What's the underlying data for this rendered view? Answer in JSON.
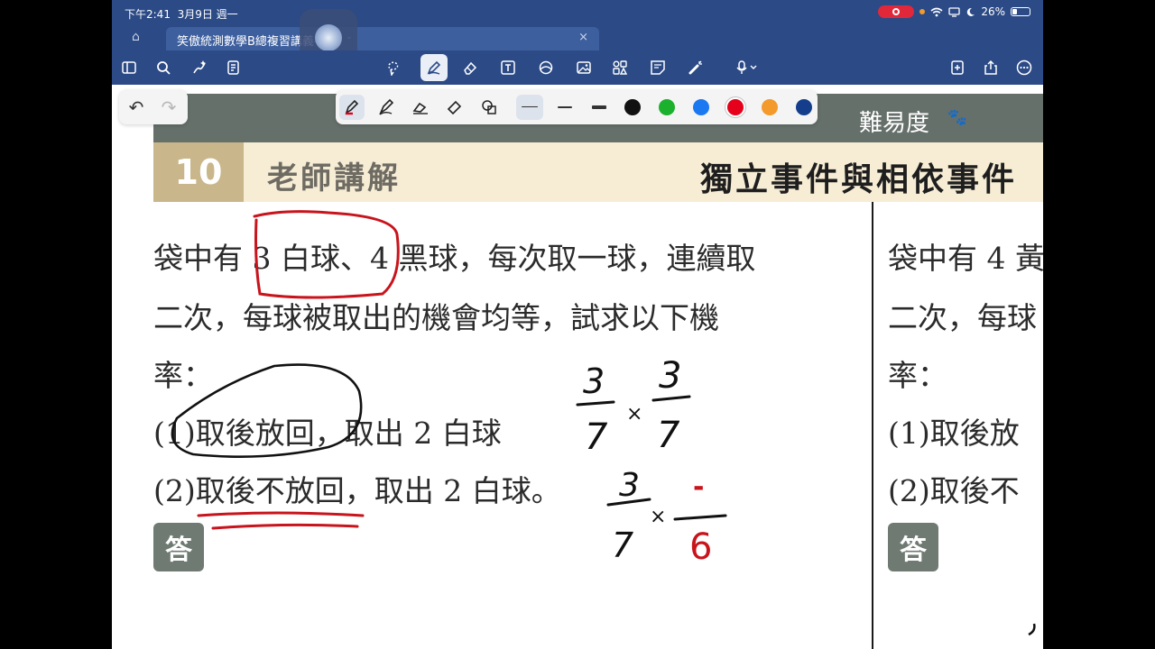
{
  "status_bar": {
    "time": "下午2:41",
    "date": "3月9日 週一",
    "battery": "26%"
  },
  "tab": {
    "title": "笑傲統測數學B總複習講義-三乙"
  },
  "toolbar": {
    "icons": [
      "sidebar-icon",
      "search-icon",
      "sparkle-icon",
      "document-icon",
      "lasso-icon",
      "pen-icon",
      "eraser-icon",
      "text-icon",
      "shapes-icon",
      "image-icon",
      "elements-icon",
      "sticky-note-icon",
      "laser-pointer-icon",
      "microphone-icon",
      "add-page-icon",
      "share-icon",
      "more-icon"
    ]
  },
  "pen_palette": {
    "tools": [
      "pen",
      "pencil",
      "highlighter",
      "eraser",
      "shapes"
    ],
    "colors": [
      "#111111",
      "#1bb12c",
      "#1a78f0",
      "#e5001b",
      "#f39a2a",
      "#143e8c"
    ],
    "selected_color": "#e5001b"
  },
  "document": {
    "difficulty_label": "難易度",
    "paws": "🐾",
    "question_number": "10",
    "lecture_label": "老師講解",
    "topic": "獨立事件與相依事件",
    "question_lines": [
      "袋中有 3 白球、4 黑球，每次取一球，連續取",
      "二次，每球被取出的機會均等，試求以下機",
      "率："
    ],
    "item1": "(1)取後放回，取出 2 白球",
    "item2": "(2)取後不放回，取出 2 白球。",
    "answer_badge": "答",
    "right_col_lines": [
      "袋中有 4 黃",
      "二次，每球",
      "率："
    ],
    "right_item1": "(1)取後放",
    "right_item2": "(2)取後不",
    "handwriting": {
      "hw1_num1": "3",
      "hw1_den1": "7",
      "hw1_op": "×",
      "hw1_num2": "3",
      "hw1_den2": "7",
      "hw2_num1": "3",
      "hw2_den1": "7",
      "hw2_op": "×",
      "hw2_num2": "-",
      "hw2_den2": "6"
    }
  }
}
